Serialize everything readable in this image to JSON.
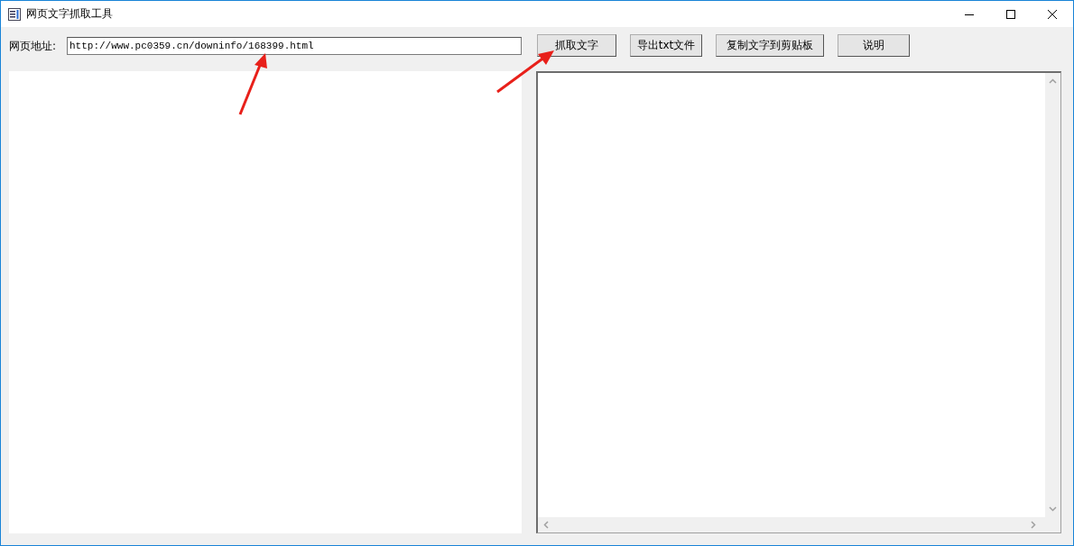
{
  "window": {
    "title": "网页文字抓取工具"
  },
  "url": {
    "label": "网页地址:",
    "value": "http://www.pc0359.cn/downinfo/168399.html"
  },
  "buttons": [
    "抓取文字",
    "导出txt文件",
    "复制文字到剪贴板",
    "说明"
  ]
}
